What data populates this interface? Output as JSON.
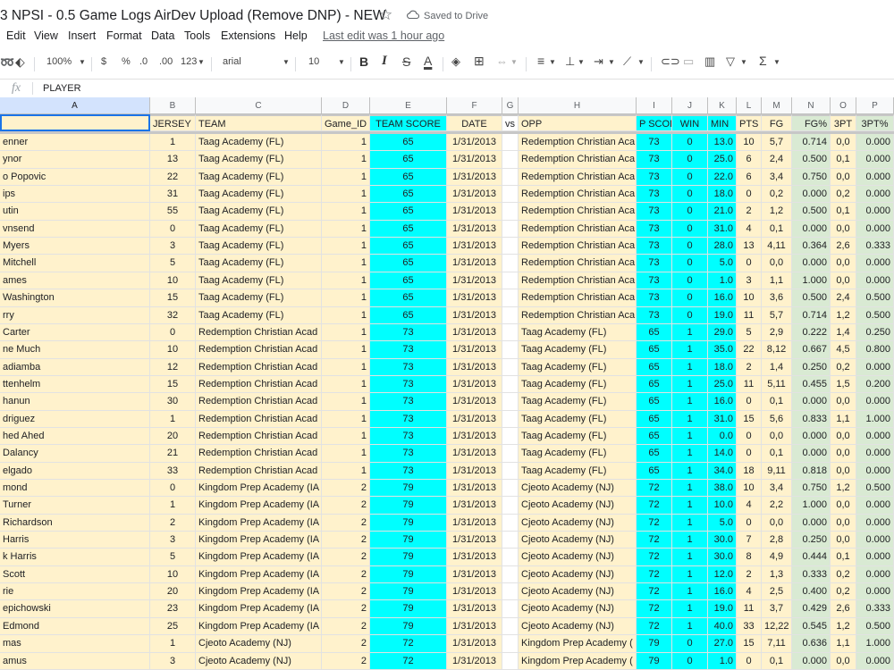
{
  "doc": {
    "title": "3 NPSI - 0.5 Game Logs AirDev Upload (Remove DNP) - NEW",
    "saved": "Saved to Drive"
  },
  "menu": [
    "Edit",
    "View",
    "Insert",
    "Format",
    "Data",
    "Tools",
    "Extensions",
    "Help"
  ],
  "last_edit": "Last edit was 1 hour ago",
  "toolbar": {
    "zoom": "100%",
    "currency": "$",
    "percent": "%",
    "dec_dec": ".0",
    "dec_inc": ".00",
    "format": "123",
    "font": "arial",
    "size": "10",
    "bold": "B",
    "italic": "I",
    "strike": "S",
    "textcolor": "A"
  },
  "formula": {
    "fx": "fx",
    "value": "PLAYER"
  },
  "columns": [
    "A",
    "B",
    "C",
    "D",
    "E",
    "F",
    "G",
    "H",
    "I",
    "J",
    "K",
    "L",
    "M",
    "N",
    "O",
    "P"
  ],
  "header": [
    "",
    "JERSEY",
    "TEAM",
    "Game_ID",
    "TEAM SCORE",
    "DATE",
    "vs",
    "OPP",
    "P SCOI",
    "WIN",
    "MIN",
    "PTS",
    "FG",
    "FG%",
    "3PT",
    "3PT%"
  ],
  "rows": [
    [
      "enner",
      "1",
      "Taag Academy (FL)",
      "1",
      "65",
      "1/31/2013",
      "",
      "Redemption Christian Aca",
      "73",
      "0",
      "13.0",
      "10",
      "5,7",
      "0.714",
      "0,0",
      "0.000"
    ],
    [
      "ynor",
      "13",
      "Taag Academy (FL)",
      "1",
      "65",
      "1/31/2013",
      "",
      "Redemption Christian Aca",
      "73",
      "0",
      "25.0",
      "6",
      "2,4",
      "0.500",
      "0,1",
      "0.000"
    ],
    [
      "o Popovic",
      "22",
      "Taag Academy (FL)",
      "1",
      "65",
      "1/31/2013",
      "",
      "Redemption Christian Aca",
      "73",
      "0",
      "22.0",
      "6",
      "3,4",
      "0.750",
      "0,0",
      "0.000"
    ],
    [
      "ips",
      "31",
      "Taag Academy (FL)",
      "1",
      "65",
      "1/31/2013",
      "",
      "Redemption Christian Aca",
      "73",
      "0",
      "18.0",
      "0",
      "0,2",
      "0.000",
      "0,2",
      "0.000"
    ],
    [
      "utin",
      "55",
      "Taag Academy (FL)",
      "1",
      "65",
      "1/31/2013",
      "",
      "Redemption Christian Aca",
      "73",
      "0",
      "21.0",
      "2",
      "1,2",
      "0.500",
      "0,1",
      "0.000"
    ],
    [
      "vnsend",
      "0",
      "Taag Academy (FL)",
      "1",
      "65",
      "1/31/2013",
      "",
      "Redemption Christian Aca",
      "73",
      "0",
      "31.0",
      "4",
      "0,1",
      "0.000",
      "0,0",
      "0.000"
    ],
    [
      "Myers",
      "3",
      "Taag Academy (FL)",
      "1",
      "65",
      "1/31/2013",
      "",
      "Redemption Christian Aca",
      "73",
      "0",
      "28.0",
      "13",
      "4,11",
      "0.364",
      "2,6",
      "0.333"
    ],
    [
      "Mitchell",
      "5",
      "Taag Academy (FL)",
      "1",
      "65",
      "1/31/2013",
      "",
      "Redemption Christian Aca",
      "73",
      "0",
      "5.0",
      "0",
      "0,0",
      "0.000",
      "0,0",
      "0.000"
    ],
    [
      "ames",
      "10",
      "Taag Academy (FL)",
      "1",
      "65",
      "1/31/2013",
      "",
      "Redemption Christian Aca",
      "73",
      "0",
      "1.0",
      "3",
      "1,1",
      "1.000",
      "0,0",
      "0.000"
    ],
    [
      "Washington",
      "15",
      "Taag Academy (FL)",
      "1",
      "65",
      "1/31/2013",
      "",
      "Redemption Christian Aca",
      "73",
      "0",
      "16.0",
      "10",
      "3,6",
      "0.500",
      "2,4",
      "0.500"
    ],
    [
      "rry",
      "32",
      "Taag Academy (FL)",
      "1",
      "65",
      "1/31/2013",
      "",
      "Redemption Christian Aca",
      "73",
      "0",
      "19.0",
      "11",
      "5,7",
      "0.714",
      "1,2",
      "0.500"
    ],
    [
      "Carter",
      "0",
      "Redemption Christian Acad",
      "1",
      "73",
      "1/31/2013",
      "",
      "Taag Academy (FL)",
      "65",
      "1",
      "29.0",
      "5",
      "2,9",
      "0.222",
      "1,4",
      "0.250"
    ],
    [
      "ne Much",
      "10",
      "Redemption Christian Acad",
      "1",
      "73",
      "1/31/2013",
      "",
      "Taag Academy (FL)",
      "65",
      "1",
      "35.0",
      "22",
      "8,12",
      "0.667",
      "4,5",
      "0.800"
    ],
    [
      "adiamba",
      "12",
      "Redemption Christian Acad",
      "1",
      "73",
      "1/31/2013",
      "",
      "Taag Academy (FL)",
      "65",
      "1",
      "18.0",
      "2",
      "1,4",
      "0.250",
      "0,2",
      "0.000"
    ],
    [
      "ttenhelm",
      "15",
      "Redemption Christian Acad",
      "1",
      "73",
      "1/31/2013",
      "",
      "Taag Academy (FL)",
      "65",
      "1",
      "25.0",
      "11",
      "5,11",
      "0.455",
      "1,5",
      "0.200"
    ],
    [
      "hanun",
      "30",
      "Redemption Christian Acad",
      "1",
      "73",
      "1/31/2013",
      "",
      "Taag Academy (FL)",
      "65",
      "1",
      "16.0",
      "0",
      "0,1",
      "0.000",
      "0,0",
      "0.000"
    ],
    [
      "driguez",
      "1",
      "Redemption Christian Acad",
      "1",
      "73",
      "1/31/2013",
      "",
      "Taag Academy (FL)",
      "65",
      "1",
      "31.0",
      "15",
      "5,6",
      "0.833",
      "1,1",
      "1.000"
    ],
    [
      "hed Ahed",
      "20",
      "Redemption Christian Acad",
      "1",
      "73",
      "1/31/2013",
      "",
      "Taag Academy (FL)",
      "65",
      "1",
      "0.0",
      "0",
      "0,0",
      "0.000",
      "0,0",
      "0.000"
    ],
    [
      "Dalancy",
      "21",
      "Redemption Christian Acad",
      "1",
      "73",
      "1/31/2013",
      "",
      "Taag Academy (FL)",
      "65",
      "1",
      "14.0",
      "0",
      "0,1",
      "0.000",
      "0,0",
      "0.000"
    ],
    [
      "elgado",
      "33",
      "Redemption Christian Acad",
      "1",
      "73",
      "1/31/2013",
      "",
      "Taag Academy (FL)",
      "65",
      "1",
      "34.0",
      "18",
      "9,11",
      "0.818",
      "0,0",
      "0.000"
    ],
    [
      "mond",
      "0",
      "Kingdom Prep Academy (IA",
      "2",
      "79",
      "1/31/2013",
      "",
      "Cjeoto Academy (NJ)",
      "72",
      "1",
      "38.0",
      "10",
      "3,4",
      "0.750",
      "1,2",
      "0.500"
    ],
    [
      "Turner",
      "1",
      "Kingdom Prep Academy (IA",
      "2",
      "79",
      "1/31/2013",
      "",
      "Cjeoto Academy (NJ)",
      "72",
      "1",
      "10.0",
      "4",
      "2,2",
      "1.000",
      "0,0",
      "0.000"
    ],
    [
      "Richardson",
      "2",
      "Kingdom Prep Academy (IA",
      "2",
      "79",
      "1/31/2013",
      "",
      "Cjeoto Academy (NJ)",
      "72",
      "1",
      "5.0",
      "0",
      "0,0",
      "0.000",
      "0,0",
      "0.000"
    ],
    [
      " Harris",
      "3",
      "Kingdom Prep Academy (IA",
      "2",
      "79",
      "1/31/2013",
      "",
      "Cjeoto Academy (NJ)",
      "72",
      "1",
      "30.0",
      "7",
      "2,8",
      "0.250",
      "0,0",
      "0.000"
    ],
    [
      "k Harris",
      "5",
      "Kingdom Prep Academy (IA",
      "2",
      "79",
      "1/31/2013",
      "",
      "Cjeoto Academy (NJ)",
      "72",
      "1",
      "30.0",
      "8",
      "4,9",
      "0.444",
      "0,1",
      "0.000"
    ],
    [
      "Scott",
      "10",
      "Kingdom Prep Academy (IA",
      "2",
      "79",
      "1/31/2013",
      "",
      "Cjeoto Academy (NJ)",
      "72",
      "1",
      "12.0",
      "2",
      "1,3",
      "0.333",
      "0,2",
      "0.000"
    ],
    [
      "rie",
      "20",
      "Kingdom Prep Academy (IA",
      "2",
      "79",
      "1/31/2013",
      "",
      "Cjeoto Academy (NJ)",
      "72",
      "1",
      "16.0",
      "4",
      "2,5",
      "0.400",
      "0,2",
      "0.000"
    ],
    [
      "epichowski",
      "23",
      "Kingdom Prep Academy (IA",
      "2",
      "79",
      "1/31/2013",
      "",
      "Cjeoto Academy (NJ)",
      "72",
      "1",
      "19.0",
      "11",
      "3,7",
      "0.429",
      "2,6",
      "0.333"
    ],
    [
      "Edmond",
      "25",
      "Kingdom Prep Academy (IA",
      "2",
      "79",
      "1/31/2013",
      "",
      "Cjeoto Academy (NJ)",
      "72",
      "1",
      "40.0",
      "33",
      "12,22",
      "0.545",
      "1,2",
      "0.500"
    ],
    [
      "mas",
      "1",
      "Cjeoto Academy (NJ)",
      "2",
      "72",
      "1/31/2013",
      "",
      "Kingdom Prep Academy (",
      "79",
      "0",
      "27.0",
      "15",
      "7,11",
      "0.636",
      "1,1",
      "1.000"
    ],
    [
      "amus",
      "3",
      "Cjeoto Academy (NJ)",
      "2",
      "72",
      "1/31/2013",
      "",
      "Kingdom Prep Academy (",
      "79",
      "0",
      "1.0",
      "0",
      "0,1",
      "0.000",
      "0,0",
      "0.000"
    ]
  ]
}
